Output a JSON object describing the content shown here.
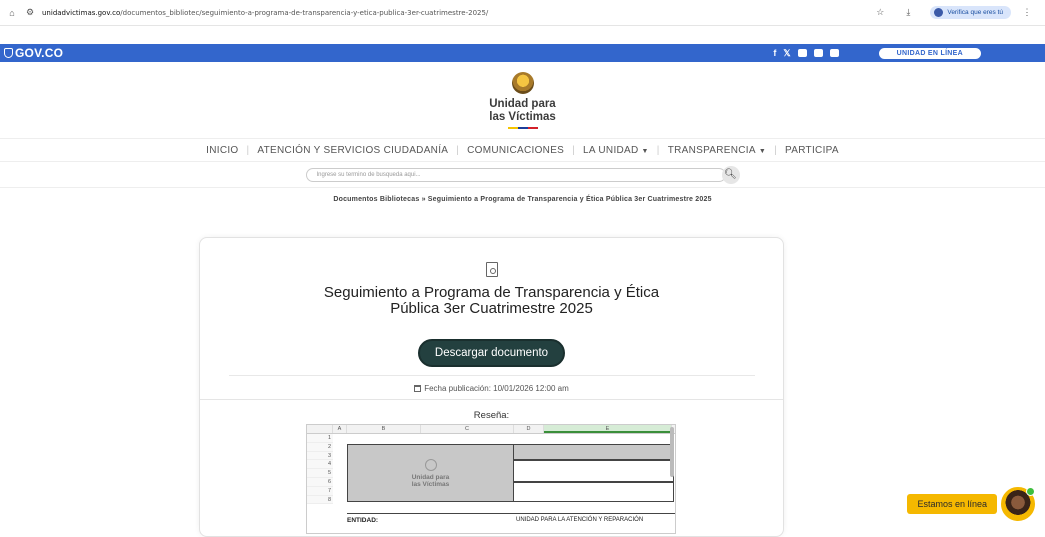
{
  "browser": {
    "url_host": "unidadvictimas.gov.co",
    "url_path": "/documentos_bibliotec/seguimiento-a-programa-de-transparencia-y-etica-publica-3er-cuatrimestre-2025/",
    "verify_label": "Verifica que eres tú"
  },
  "gov_bar": {
    "logo": "GOV.CO",
    "unidad_button": "UNIDAD EN LÍNEA",
    "color": "#3366cc"
  },
  "header": {
    "logo_line1": "Unidad para",
    "logo_line2": "las Víctimas"
  },
  "nav": {
    "items": [
      {
        "label": "INICIO",
        "dropdown": false
      },
      {
        "label": "ATENCIÓN Y SERVICIOS CIUDADANÍA",
        "dropdown": false
      },
      {
        "label": "COMUNICACIONES",
        "dropdown": false
      },
      {
        "label": "LA UNIDAD",
        "dropdown": true
      },
      {
        "label": "TRANSPARENCIA",
        "dropdown": true
      },
      {
        "label": "PARTICIPA",
        "dropdown": false
      }
    ]
  },
  "search": {
    "placeholder": "Ingrese su termino de busqueda aqui..."
  },
  "breadcrumb": {
    "text": "Documentos Bibliotecas » Seguimiento a Programa de Transparencia y Ética Pública 3er Cuatrimestre 2025"
  },
  "document": {
    "title": "Seguimiento a Programa de Transparencia y Ética Pública 3er Cuatrimestre 2025",
    "download_label": "Descargar documento",
    "date_label": "Fecha publicación: 10/01/2026 12:00 am",
    "resena_label": "Reseña:",
    "button_color": "#23403f"
  },
  "sheet": {
    "columns": [
      "A",
      "B",
      "C",
      "D",
      "E"
    ],
    "rows": [
      "1",
      "2",
      "3",
      "4",
      "5",
      "6",
      "7",
      "8"
    ],
    "logo_line1": "Unidad para",
    "logo_line2": "las Víctimas",
    "entidad_label": "ENTIDAD:",
    "entidad_value": "UNIDAD PARA LA ATENCIÓN Y REPARACIÓN"
  },
  "chat": {
    "label": "Estamos en línea",
    "color": "#f5b800"
  }
}
